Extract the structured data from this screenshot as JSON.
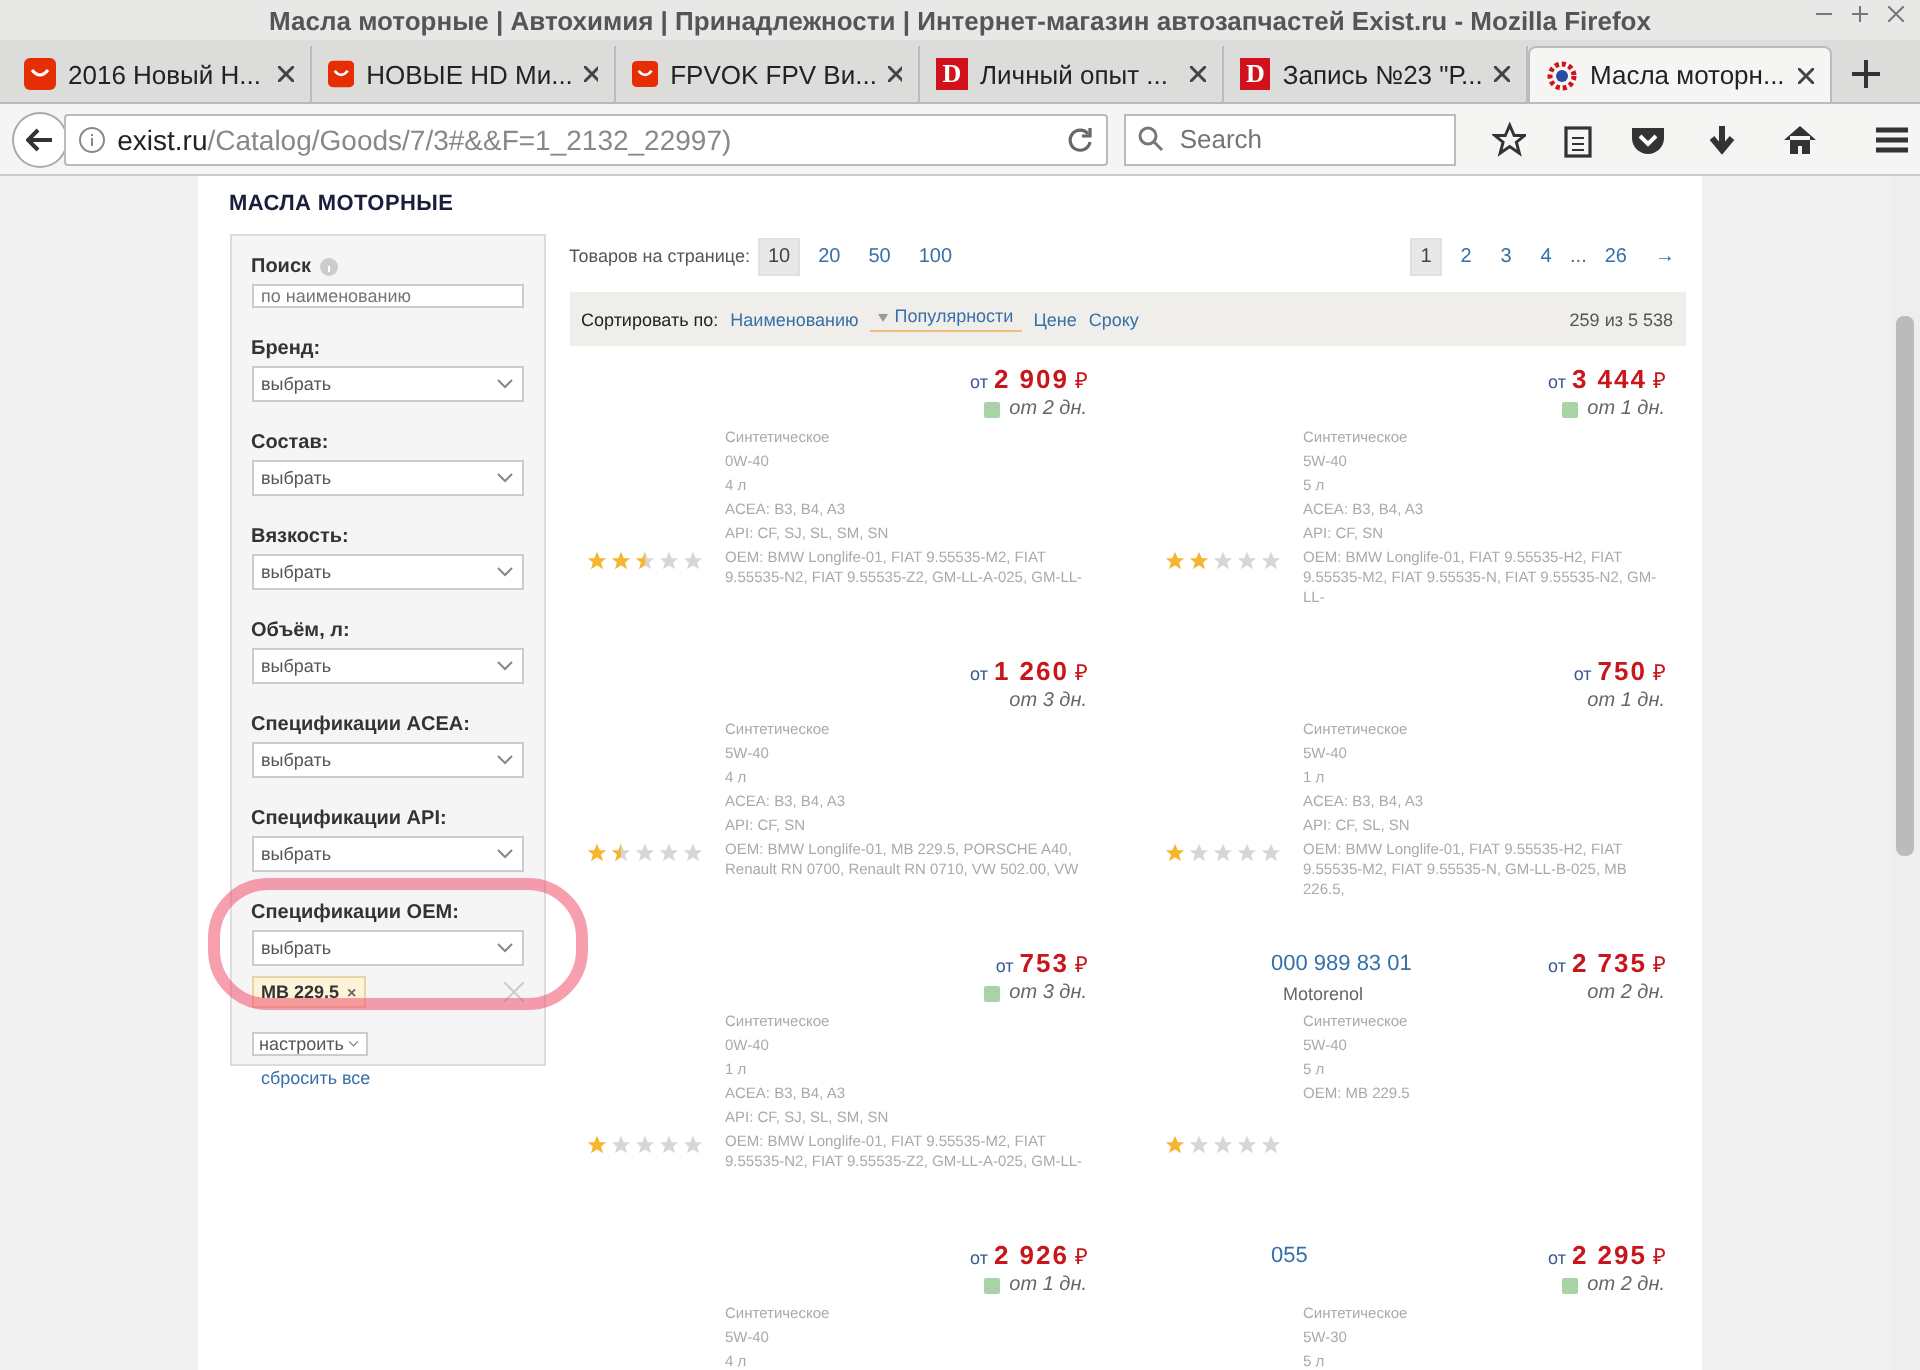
{
  "browser": {
    "title": "Масла моторные | Автохимия | Принадлежности | Интернет-магазин автозапчастей Exist.ru - Mozilla Firefox",
    "tabs": [
      {
        "label": "2016 Новый Н...",
        "selected": false,
        "kind": "bag"
      },
      {
        "label": "НОВЫЕ HD Ми...",
        "selected": false,
        "kind": "bag"
      },
      {
        "label": "FPVOK FPV Ви...",
        "selected": false,
        "kind": "bag"
      },
      {
        "label": "Личный опыт ...",
        "selected": false,
        "kind": "letter",
        "icon_text": "D"
      },
      {
        "label": "Запись №23 \"Р...",
        "selected": false,
        "kind": "letter",
        "icon_text": "D"
      },
      {
        "label": "Масла моторн...",
        "selected": true,
        "kind": "site"
      }
    ],
    "address": {
      "host": "exist.ru",
      "path": "/Catalog/Goods/7/3#&&F=1_2132_22997)"
    },
    "search": {
      "placeholder": "Search"
    }
  },
  "page": {
    "heading": "МАСЛА МОТОРНЫЕ",
    "filters": {
      "search_label": "Поиск",
      "search_placeholder": "по наименованию",
      "selects": [
        {
          "label": "Бренд:",
          "value": "выбрать"
        },
        {
          "label": "Состав:",
          "value": "выбрать"
        },
        {
          "label": "Вязкость:",
          "value": "выбрать"
        },
        {
          "label": "Объём, л:",
          "value": "выбрать"
        },
        {
          "label": "Спецификации ACEA:",
          "value": "выбрать"
        },
        {
          "label": "Спецификации API:",
          "value": "выбрать"
        },
        {
          "label": "Спецификации OEM:",
          "value": "выбрать",
          "highlighted": true
        }
      ],
      "selected_tags": [
        {
          "label": "MB 229.5",
          "remove": "×"
        }
      ],
      "settings_button": "настроить",
      "reset_link": "сбросить все"
    },
    "per_page": {
      "label": "Товаров на странице:",
      "options": [
        {
          "label": "10",
          "selected": true
        },
        {
          "label": "20",
          "selected": false
        },
        {
          "label": "50",
          "selected": false
        },
        {
          "label": "100",
          "selected": false
        }
      ]
    },
    "pagination": [
      {
        "label": "1",
        "selected": true
      },
      {
        "label": "2",
        "selected": false
      },
      {
        "label": "3",
        "selected": false
      },
      {
        "label": "4",
        "selected": false
      },
      {
        "label": "...",
        "kind": "gap"
      },
      {
        "label": "26",
        "selected": false
      },
      {
        "label": "→",
        "selected": false
      }
    ],
    "sort": {
      "label": "Сортировать по:",
      "options": [
        {
          "label": "Наименованию",
          "selected": false
        },
        {
          "label": "Популярности",
          "selected": true
        },
        {
          "label": "Цене",
          "selected": false
        },
        {
          "label": "Сроку",
          "selected": false
        }
      ],
      "count": "259 из 5 538"
    },
    "products": [
      {
        "from": "от",
        "price": "2 909",
        "currency": "₽",
        "in_stock": true,
        "delivery": "от 2 дн.",
        "stars": 2.5,
        "specs": [
          "Синтетическое",
          "0W-40",
          "4 л",
          "ACEA: B3, B4, A3",
          "API: CF, SJ, SL, SM, SN",
          "OEM: BMW Longlife-01, FIAT 9.55535-M2, FIAT 9.55535-N2, FIAT 9.55535-Z2, GM-LL-A-025, GM-LL-"
        ]
      },
      {
        "from": "от",
        "price": "3 444",
        "currency": "₽",
        "in_stock": true,
        "delivery": "от 1 дн.",
        "stars": 2,
        "specs": [
          "Синтетическое",
          "5W-40",
          "5 л",
          "ACEA: B3, B4, A3",
          "API: CF, SN",
          "OEM: BMW Longlife-01, FIAT 9.55535-H2, FIAT 9.55535-M2, FIAT 9.55535-N, FIAT 9.55535-N2, GM-LL-"
        ]
      },
      {
        "from": "от",
        "price": "1 260",
        "currency": "₽",
        "in_stock": false,
        "delivery": "от 3 дн.",
        "stars": 1.5,
        "specs": [
          "Синтетическое",
          "5W-40",
          "4 л",
          "ACEA: B3, B4, A3",
          "API: CF, SN",
          "OEM: BMW Longlife-01, MB 229.5, PORSCHE A40, Renault RN 0700, Renault RN 0710, VW 502.00, VW"
        ]
      },
      {
        "from": "от",
        "price": "750",
        "currency": "₽",
        "in_stock": false,
        "delivery": "от 1 дн.",
        "stars": 1,
        "specs": [
          "Синтетическое",
          "5W-40",
          "1 л",
          "ACEA: B3, B4, A3",
          "API: CF, SL, SN",
          "OEM: BMW Longlife-01, FIAT 9.55535-H2, FIAT 9.55535-M2, FIAT 9.55535-N, GM-LL-B-025, MB 226.5,"
        ]
      },
      {
        "from": "от",
        "price": "753",
        "currency": "₽",
        "in_stock": true,
        "delivery": "от 3 дн.",
        "stars": 1,
        "specs": [
          "Синтетическое",
          "0W-40",
          "1 л",
          "ACEA: B3, B4, A3",
          "API: CF, SJ, SL, SM, SN",
          "OEM: BMW Longlife-01, FIAT 9.55535-M2, FIAT 9.55535-N2, FIAT 9.55535-Z2, GM-LL-A-025, GM-LL-"
        ]
      },
      {
        "from": "от",
        "price": "2 735",
        "currency": "₽",
        "in_stock": false,
        "delivery": "от 2 дн.",
        "stars": 1,
        "code": "000 989 83 01",
        "brand": "Motorenol",
        "specs": [
          "Синтетическое",
          "5W-40",
          "5 л",
          "OEM: MB 229.5"
        ]
      },
      {
        "from": "от",
        "price": "2 926",
        "currency": "₽",
        "in_stock": true,
        "delivery": "от 1 дн.",
        "specs": [
          "Синтетическое",
          "5W-40",
          "4 л"
        ]
      },
      {
        "from": "от",
        "price": "2 295",
        "currency": "₽",
        "in_stock": true,
        "delivery": "от 2 дн.",
        "code": "055",
        "specs": [
          "Синтетическое",
          "5W-30",
          "5 л"
        ]
      }
    ]
  }
}
